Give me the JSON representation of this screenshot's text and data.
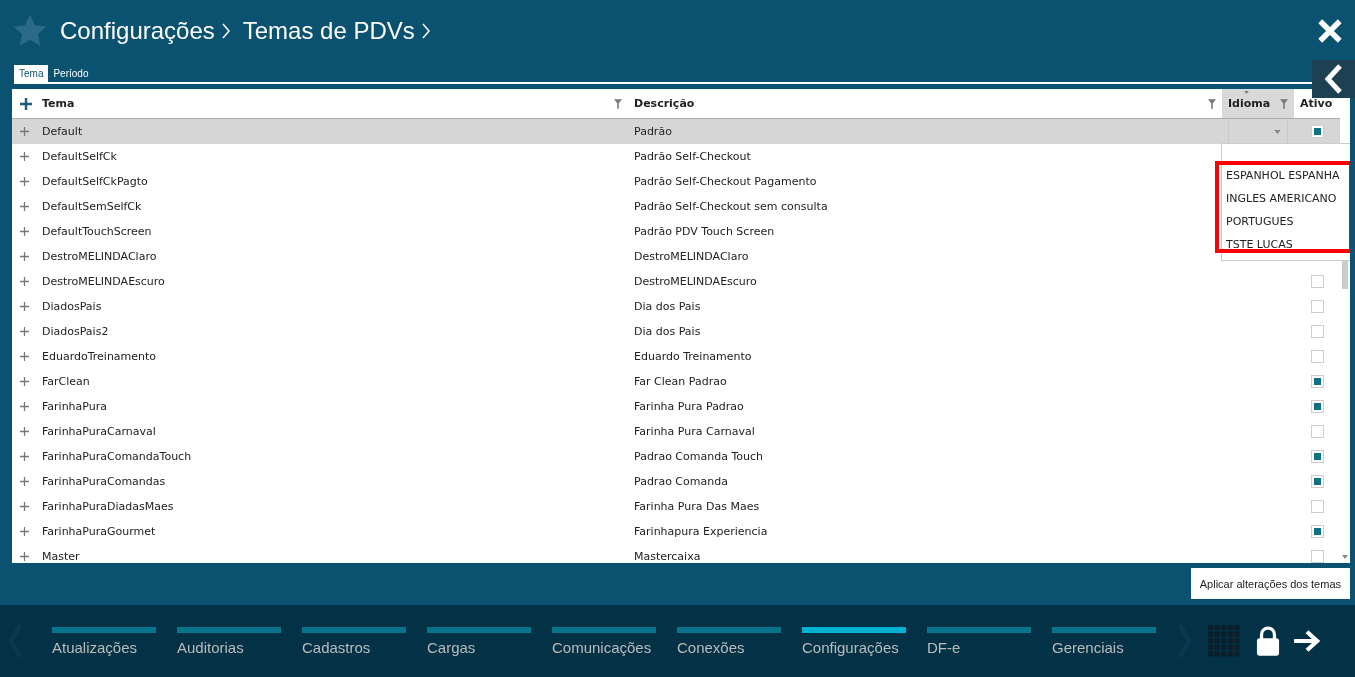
{
  "header": {
    "breadcrumb": [
      "Configurações",
      "Temas de PDVs"
    ]
  },
  "tabs": [
    {
      "label": "Tema",
      "selected": true
    },
    {
      "label": "Período",
      "selected": false
    }
  ],
  "table": {
    "columns": [
      "Tema",
      "Descrição",
      "Idioma",
      "Ativo"
    ],
    "rows": [
      {
        "tema": "Default",
        "descricao": "Padrão",
        "selected": true,
        "ativo": true
      },
      {
        "tema": "DefaultSelfCk",
        "descricao": "Padrão Self-Checkout",
        "selected": false
      },
      {
        "tema": "DefaultSelfCkPagto",
        "descricao": "Padrão Self-Checkout Pagamento",
        "selected": false
      },
      {
        "tema": "DefaultSemSelfCk",
        "descricao": "Padrão Self-Checkout sem consulta",
        "selected": false
      },
      {
        "tema": "DefaultTouchScreen",
        "descricao": "Padrão PDV Touch Screen",
        "selected": false
      },
      {
        "tema": "DestroMELINDAClaro",
        "descricao": "DestroMELINDAClaro",
        "selected": false
      },
      {
        "tema": "DestroMELINDAEscuro",
        "descricao": "DestroMELINDAEscuro",
        "selected": false,
        "ativo": false
      },
      {
        "tema": "DiadosPais",
        "descricao": "Dia dos Pais",
        "selected": false,
        "ativo": false
      },
      {
        "tema": "DiadosPais2",
        "descricao": "Dia dos Pais",
        "selected": false,
        "ativo": false
      },
      {
        "tema": "EduardoTreinamento",
        "descricao": "Eduardo Treinamento",
        "selected": false,
        "ativo": false
      },
      {
        "tema": "FarClean",
        "descricao": "Far Clean Padrao",
        "selected": false,
        "ativo": true
      },
      {
        "tema": "FarinhaPura",
        "descricao": "Farinha Pura Padrao",
        "selected": false,
        "ativo": true
      },
      {
        "tema": "FarinhaPuraCarnaval",
        "descricao": "Farinha Pura Carnaval",
        "selected": false,
        "ativo": false
      },
      {
        "tema": "FarinhaPuraComandaTouch",
        "descricao": "Padrao Comanda Touch",
        "selected": false,
        "ativo": true
      },
      {
        "tema": "FarinhaPuraComandas",
        "descricao": "Padrao Comanda",
        "selected": false,
        "ativo": true
      },
      {
        "tema": "FarinhaPuraDiadasMaes",
        "descricao": "Farinha Pura Das Maes",
        "selected": false,
        "ativo": false
      },
      {
        "tema": "FarinhaPuraGourmet",
        "descricao": "Farinhapura Experiencia",
        "selected": false,
        "ativo": true
      },
      {
        "tema": "Master",
        "descricao": "Mastercaixa",
        "selected": false,
        "ativo": false
      }
    ]
  },
  "idioma_dropdown": {
    "options": [
      "ESPANHOL ESPANHA",
      "INGLES AMERICANO",
      "PORTUGUES",
      "TSTE LUCAS"
    ]
  },
  "apply_button": "Aplicar alterações dos temas",
  "nav": [
    {
      "label": "Atualizações",
      "selected": false
    },
    {
      "label": "Auditorias",
      "selected": false
    },
    {
      "label": "Cadastros",
      "selected": false
    },
    {
      "label": "Cargas",
      "selected": false
    },
    {
      "label": "Comunicações",
      "selected": false
    },
    {
      "label": "Conexões",
      "selected": false
    },
    {
      "label": "Configurações",
      "selected": true
    },
    {
      "label": "DF-e",
      "selected": false
    },
    {
      "label": "Gerenciais",
      "selected": false
    }
  ]
}
